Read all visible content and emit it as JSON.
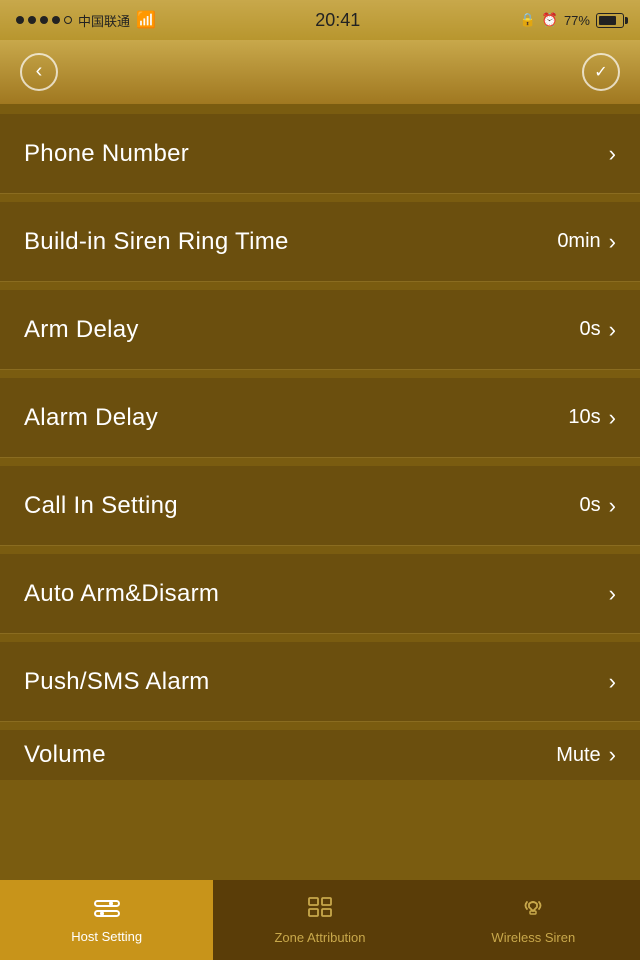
{
  "statusBar": {
    "carrier": "中国联通",
    "time": "20:41",
    "battery": "77%"
  },
  "nav": {
    "back_label": "‹",
    "confirm_label": "✓"
  },
  "listItems": [
    {
      "label": "Phone Number",
      "value": "",
      "hasChevron": true
    },
    {
      "label": "Build-in Siren Ring Time",
      "value": "0min",
      "hasChevron": true
    },
    {
      "label": "Arm Delay",
      "value": "0s",
      "hasChevron": true
    },
    {
      "label": "Alarm Delay",
      "value": "10s",
      "hasChevron": true
    },
    {
      "label": "Call In Setting",
      "value": "0s",
      "hasChevron": true
    },
    {
      "label": "Auto Arm&Disarm",
      "value": "",
      "hasChevron": true
    },
    {
      "label": "Push/SMS Alarm",
      "value": "",
      "hasChevron": true
    },
    {
      "label": "Volume",
      "value": "Mute",
      "hasChevron": true,
      "partial": true
    }
  ],
  "tabs": [
    {
      "id": "host-setting",
      "label": "Host Setting",
      "icon": "⊟",
      "active": true
    },
    {
      "id": "zone-attribution",
      "label": "Zone Attribution",
      "icon": "▦",
      "active": false
    },
    {
      "id": "wireless-siren",
      "label": "Wireless Siren",
      "icon": "🔔",
      "active": false
    }
  ]
}
